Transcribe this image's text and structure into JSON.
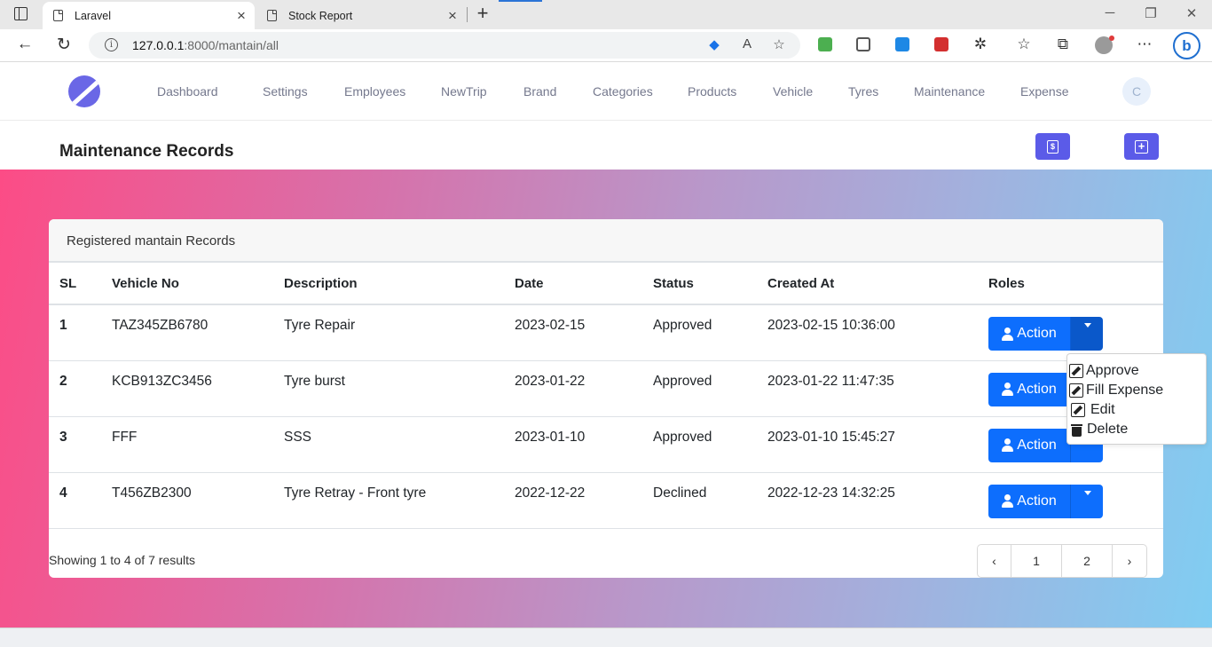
{
  "browser": {
    "tabs": [
      {
        "title": "Laravel"
      },
      {
        "title": "Stock Report"
      }
    ],
    "url_host": "127.0.0.1",
    "url_rest": ":8000/mantain/all"
  },
  "nav": {
    "items": [
      {
        "label": "Dashboard"
      },
      {
        "label": "Settings"
      },
      {
        "label": "Employees"
      },
      {
        "label": "NewTrip"
      },
      {
        "label": "Brand"
      },
      {
        "label": "Categories"
      },
      {
        "label": "Products"
      },
      {
        "label": "Vehicle"
      },
      {
        "label": "Tyres"
      },
      {
        "label": "Maintenance"
      },
      {
        "label": "Expense"
      }
    ],
    "user_initial": "C"
  },
  "page": {
    "title": "Maintenance Records"
  },
  "card": {
    "header": "Registered mantain Records",
    "columns": [
      "SL",
      "Vehicle No",
      "Description",
      "Date",
      "Status",
      "Created At",
      "Roles"
    ],
    "rows": [
      {
        "sl": "1",
        "vehicle_no": "TAZ345ZB6780",
        "description": "Tyre Repair",
        "date": "2023-02-15",
        "status": "Approved",
        "created_at": "2023-02-15 10:36:00",
        "action": "Action"
      },
      {
        "sl": "2",
        "vehicle_no": "KCB913ZC3456",
        "description": "Tyre burst",
        "date": "2023-01-22",
        "status": "Approved",
        "created_at": "2023-01-22 11:47:35",
        "action": "Action"
      },
      {
        "sl": "3",
        "vehicle_no": "FFF",
        "description": "SSS",
        "date": "2023-01-10",
        "status": "Approved",
        "created_at": "2023-01-10 15:45:27",
        "action": "Action"
      },
      {
        "sl": "4",
        "vehicle_no": "T456ZB2300",
        "description": "Tyre Retray - Front tyre",
        "date": "2022-12-22",
        "status": "Declined",
        "created_at": "2022-12-23 14:32:25",
        "action": "Action"
      }
    ],
    "footer_text": "Showing 1 to 4 of 7 results",
    "pagination": {
      "prev": "‹",
      "pages": [
        "1",
        "2"
      ],
      "next": "›"
    }
  },
  "dropdown": {
    "items": [
      {
        "label": "Approve",
        "icon": "edit-icon"
      },
      {
        "label": "Fill Expense",
        "icon": "edit-icon"
      },
      {
        "label": "Edit",
        "icon": "edit-icon"
      },
      {
        "label": "Delete",
        "icon": "trash-icon"
      }
    ]
  },
  "colors": {
    "primary_button": "#0d6efd",
    "header_button": "#5b5be8",
    "logo": "#6a67e6"
  }
}
